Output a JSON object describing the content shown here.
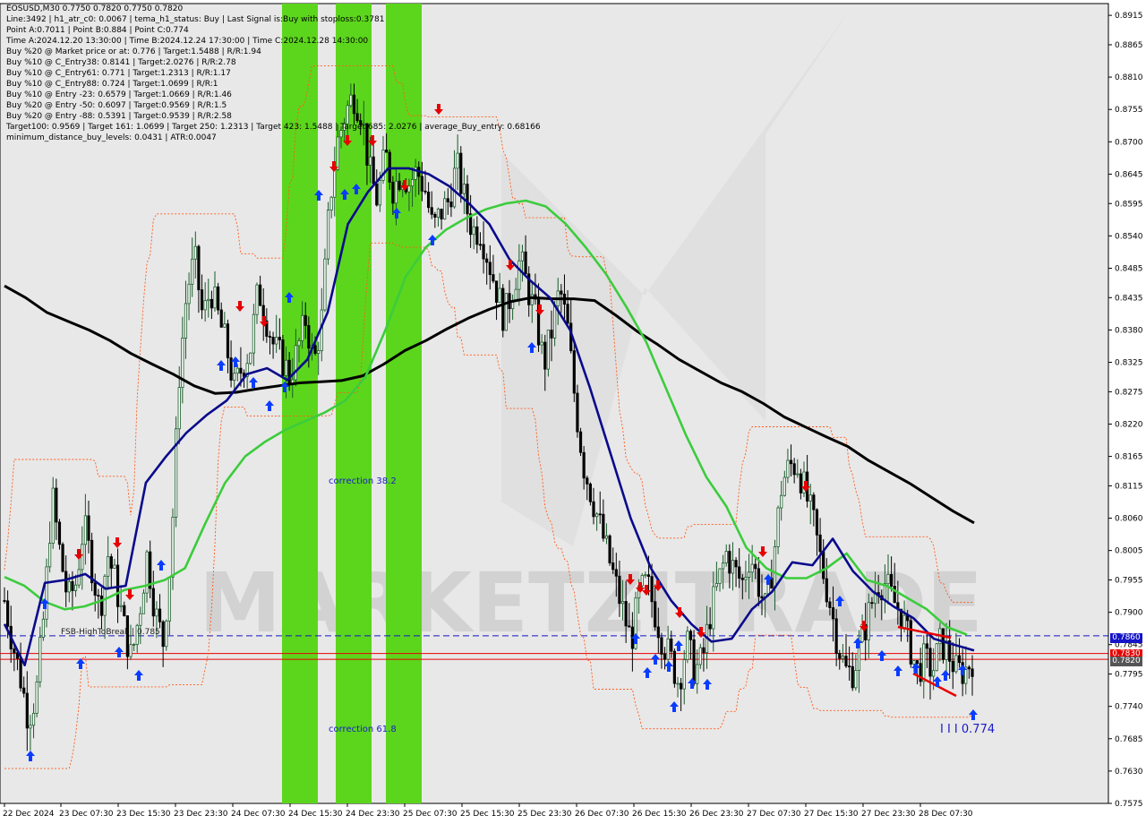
{
  "header": {
    "lines": [
      "EOSUSD,M30  0.7750 0.7820 0.7750 0.7820",
      "Line:3492 | h1_atr_c0: 0.0067 | tema_h1_status: Buy | Last Signal is:Buy with stoploss:0.3781",
      "Point A:0.7011 | Point B:0.884 | Point C:0.774",
      "Time A:2024.12.20 13:30:00 | Time B:2024.12.24 17:30:00 | Time C:2024.12.28 14:30:00",
      "Buy %20 @ Market price or at: 0.776 | Target:1.5488 | R/R:1.94",
      "Buy %10 @ C_Entry38: 0.8141 | Target:2.0276 | R/R:2.78",
      "Buy %10 @ C_Entry61: 0.771 | Target:1.2313 | R/R:1.17",
      "Buy %10 @ C_Entry88: 0.724 | Target:1.0699 | R/R:1",
      "Buy %10 @ Entry -23: 0.6579 | Target:1.0669 | R/R:1.46",
      "Buy %20 @ Entry -50: 0.6097 | Target:0.9569 | R/R:1.5",
      "Buy %20 @ Entry -88: 0.5391 | Target:0.9539 | R/R:2.58",
      "Target100: 0.9569 | Target 161: 1.0699 | Target 250: 1.2313 | Target 423: 1.5488 | Target 685: 2.0276 | average_Buy_entry: 0.68166",
      "minimum_distance_buy_levels: 0.0431 | ATR:0.0047"
    ]
  },
  "annotations": {
    "correction_382": "correction 38.2",
    "correction_618": "correction 61.8",
    "fsb_label": "FSB-HighToBreak | 0.785",
    "target_label": "I I I 0.774",
    "watermark": "MARKETZITRADE"
  },
  "colors": {
    "background": "#ffffff",
    "plot_bg": "#e8e8e8",
    "bull": "#1a5c2a",
    "bear": "#000000",
    "ma_black": "#000000",
    "ma_green": "#3ccc3c",
    "ma_navy": "#0a0a8c",
    "channel": "#ff5a1a",
    "zone_green": "#5cd61c",
    "buy_arrow": "#0a3cff",
    "sell_arrow": "#e60000",
    "hline_blue": "#1414c8",
    "hline_red": "#e60000",
    "tag_blue": "#1414c8",
    "tag_red": "#e60000",
    "tag_gray": "#555555"
  },
  "price_tags": [
    {
      "value": "0.7860",
      "kind": "blue"
    },
    {
      "value": "0.7830",
      "kind": "red"
    },
    {
      "value": "0.7820",
      "kind": "gray"
    }
  ],
  "chart_data": {
    "type": "candlestick",
    "symbol": "EOSUSD",
    "timeframe": "M30",
    "ylim": [
      0.7575,
      0.8935
    ],
    "y_ticks": [
      "0.8915",
      "0.8865",
      "0.8810",
      "0.8755",
      "0.8700",
      "0.8645",
      "0.8595",
      "0.8540",
      "0.8485",
      "0.8435",
      "0.8380",
      "0.8325",
      "0.8275",
      "0.8220",
      "0.8165",
      "0.8115",
      "0.8060",
      "0.8005",
      "0.7955",
      "0.7900",
      "0.7845",
      "0.7795",
      "0.7740",
      "0.7685",
      "0.7630",
      "0.7575"
    ],
    "x_ticks": [
      "22 Dec 2024",
      "23 Dec 07:30",
      "23 Dec 15:30",
      "23 Dec 23:30",
      "24 Dec 07:30",
      "24 Dec 15:30",
      "24 Dec 23:30",
      "25 Dec 07:30",
      "25 Dec 15:30",
      "25 Dec 23:30",
      "26 Dec 07:30",
      "26 Dec 15:30",
      "26 Dec 23:30",
      "27 Dec 07:30",
      "27 Dec 15:30",
      "27 Dec 23:30",
      "28 Dec 07:30"
    ],
    "hlines": [
      {
        "value": 0.786,
        "style": "dashed",
        "color": "hline_blue"
      },
      {
        "value": 0.783,
        "style": "solid",
        "color": "hline_red"
      },
      {
        "value": 0.782,
        "style": "solid",
        "color": "hline_red"
      }
    ],
    "zones": [
      {
        "label": "correction 38.2 / 61.8",
        "x_range": [
          "24 Dec 13:30",
          "24 Dec 17:30"
        ]
      },
      {
        "x_range": [
          "24 Dec 19:30",
          "24 Dec 23:30"
        ]
      },
      {
        "x_range": [
          "25 Dec 01:00",
          "25 Dec 05:00"
        ]
      }
    ],
    "close_path": [
      0.792,
      0.785,
      0.779,
      0.772,
      0.776,
      0.79,
      0.81,
      0.8,
      0.792,
      0.795,
      0.805,
      0.798,
      0.79,
      0.8,
      0.795,
      0.788,
      0.782,
      0.79,
      0.8,
      0.79,
      0.785,
      0.8,
      0.83,
      0.845,
      0.85,
      0.84,
      0.845,
      0.84,
      0.835,
      0.828,
      0.832,
      0.835,
      0.845,
      0.84,
      0.835,
      0.833,
      0.83,
      0.835,
      0.84,
      0.832,
      0.84,
      0.86,
      0.87,
      0.875,
      0.878,
      0.875,
      0.865,
      0.86,
      0.868,
      0.862,
      0.865,
      0.863,
      0.865,
      0.862,
      0.855,
      0.858,
      0.86,
      0.866,
      0.86,
      0.855,
      0.855,
      0.85,
      0.845,
      0.84,
      0.845,
      0.85,
      0.845,
      0.84,
      0.832,
      0.838,
      0.845,
      0.838,
      0.825,
      0.815,
      0.81,
      0.805,
      0.8,
      0.795,
      0.79,
      0.785,
      0.793,
      0.795,
      0.79,
      0.785,
      0.782,
      0.778,
      0.785,
      0.78,
      0.782,
      0.79,
      0.795,
      0.8,
      0.797,
      0.795,
      0.8,
      0.795,
      0.79,
      0.8,
      0.812,
      0.815,
      0.815,
      0.81,
      0.805,
      0.798,
      0.792,
      0.785,
      0.78,
      0.78,
      0.785,
      0.79,
      0.795,
      0.795,
      0.792,
      0.79,
      0.785,
      0.78,
      0.782,
      0.78,
      0.785,
      0.783,
      0.78,
      0.78,
      0.782
    ],
    "series": [
      {
        "name": "",
        "color": "ma_black",
        "values": [
          0.8455,
          0.8435,
          0.841,
          0.8395,
          0.838,
          0.8362,
          0.834,
          0.8322,
          0.8305,
          0.8285,
          0.8272,
          0.8274,
          0.828,
          0.8285,
          0.829,
          0.8292,
          0.8294,
          0.8302,
          0.8322,
          0.8345,
          0.8362,
          0.8382,
          0.84,
          0.8415,
          0.8428,
          0.8435,
          0.8433,
          0.8433,
          0.843,
          0.8405,
          0.8378,
          0.8355,
          0.833,
          0.831,
          0.829,
          0.8275,
          0.8255,
          0.8232,
          0.8215,
          0.8198,
          0.8182,
          0.8158,
          0.8138,
          0.8118,
          0.8095,
          0.8072,
          0.8052
        ]
      },
      {
        "name": "",
        "color": "ma_green",
        "values": [
          0.796,
          0.7945,
          0.7918,
          0.7905,
          0.791,
          0.7922,
          0.7938,
          0.7945,
          0.7955,
          0.7975,
          0.805,
          0.812,
          0.8165,
          0.819,
          0.821,
          0.8225,
          0.824,
          0.826,
          0.83,
          0.838,
          0.847,
          0.852,
          0.855,
          0.857,
          0.8585,
          0.8595,
          0.86,
          0.859,
          0.856,
          0.852,
          0.8475,
          0.842,
          0.836,
          0.828,
          0.82,
          0.813,
          0.808,
          0.801,
          0.7975,
          0.7958,
          0.7958,
          0.7975,
          0.8,
          0.7955,
          0.7945,
          0.7925,
          0.7905,
          0.7875,
          0.7862
        ]
      },
      {
        "name": "",
        "color": "ma_navy",
        "values": [
          0.788,
          0.781,
          0.795,
          0.7955,
          0.7965,
          0.794,
          0.7945,
          0.812,
          0.8165,
          0.8205,
          0.8235,
          0.826,
          0.8305,
          0.8315,
          0.8295,
          0.833,
          0.841,
          0.856,
          0.8615,
          0.8655,
          0.8655,
          0.8645,
          0.8625,
          0.8595,
          0.856,
          0.85,
          0.8465,
          0.8435,
          0.838,
          0.828,
          0.817,
          0.806,
          0.7975,
          0.792,
          0.788,
          0.785,
          0.7855,
          0.7905,
          0.7935,
          0.7985,
          0.798,
          0.8025,
          0.797,
          0.7935,
          0.791,
          0.789,
          0.7855,
          0.7845,
          0.7835
        ]
      }
    ],
    "buy_arrows": 36,
    "sell_arrows": 21
  }
}
